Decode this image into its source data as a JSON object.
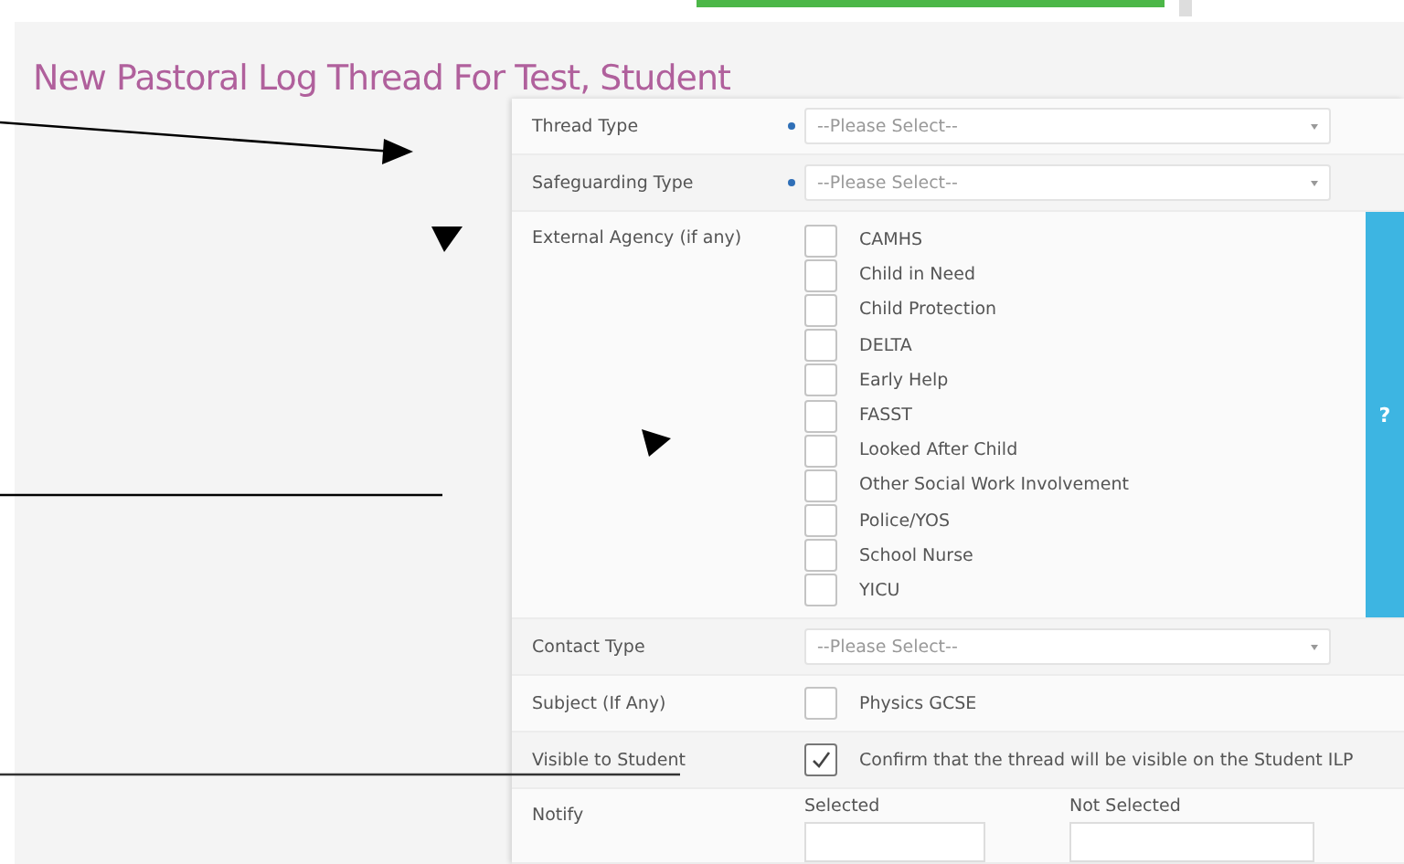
{
  "title": "New Pastoral Log Thread For Test, Student",
  "form": {
    "rows": [
      {
        "kind": "select",
        "label": "Thread Type",
        "required": true,
        "placeholder": "--Please Select--"
      },
      {
        "kind": "select",
        "label": "Safeguarding Type",
        "required": true,
        "placeholder": "--Please Select--"
      },
      {
        "kind": "checklist",
        "label": "External Agency (if any)",
        "help": "?",
        "options": [
          {
            "label": "CAMHS",
            "checked": false
          },
          {
            "label": "Child in Need",
            "checked": false
          },
          {
            "label": "Child Protection",
            "checked": false
          },
          {
            "label": "DELTA",
            "checked": false
          },
          {
            "label": "Early Help",
            "checked": false
          },
          {
            "label": "FASST",
            "checked": false
          },
          {
            "label": "Looked After Child",
            "checked": false
          },
          {
            "label": "Other Social Work Involvement",
            "checked": false
          },
          {
            "label": "Police/YOS",
            "checked": false
          },
          {
            "label": "School Nurse",
            "checked": false
          },
          {
            "label": "YICU",
            "checked": false
          }
        ]
      },
      {
        "kind": "select",
        "label": "Contact Type",
        "required": false,
        "placeholder": "--Please Select--"
      },
      {
        "kind": "checkbox",
        "label": "Subject (If Any)",
        "option": "Physics GCSE",
        "checked": false
      },
      {
        "kind": "checkbox",
        "label": "Visible to Student",
        "option": "Confirm that the thread will be visible on the Student ILP",
        "checked": true
      },
      {
        "kind": "notify",
        "label": "Notify",
        "selected_heading": "Selected",
        "not_selected_heading": "Not Selected"
      }
    ]
  }
}
